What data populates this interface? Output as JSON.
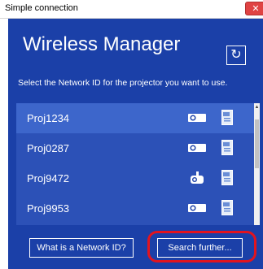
{
  "window": {
    "title": "Simple connection",
    "close_label": "✕"
  },
  "app": {
    "title": "Wireless Manager",
    "refresh_glyph": "↻"
  },
  "instruction": "Select the Network ID for the projector you want to use.",
  "projectors": [
    {
      "id": "Proj1234",
      "type": "projector",
      "selected": true
    },
    {
      "id": "Proj0287",
      "type": "projector",
      "selected": false
    },
    {
      "id": "Proj9472",
      "type": "ceiling-projector",
      "selected": false
    },
    {
      "id": "Proj9953",
      "type": "projector",
      "selected": false
    }
  ],
  "buttons": {
    "network_id": "What is a Network ID?",
    "search": "Search further..."
  },
  "colors": {
    "panel": "#1b40a8",
    "list": "#2c51b7",
    "selected": "#3d66cb",
    "highlight": "#e2141f"
  }
}
